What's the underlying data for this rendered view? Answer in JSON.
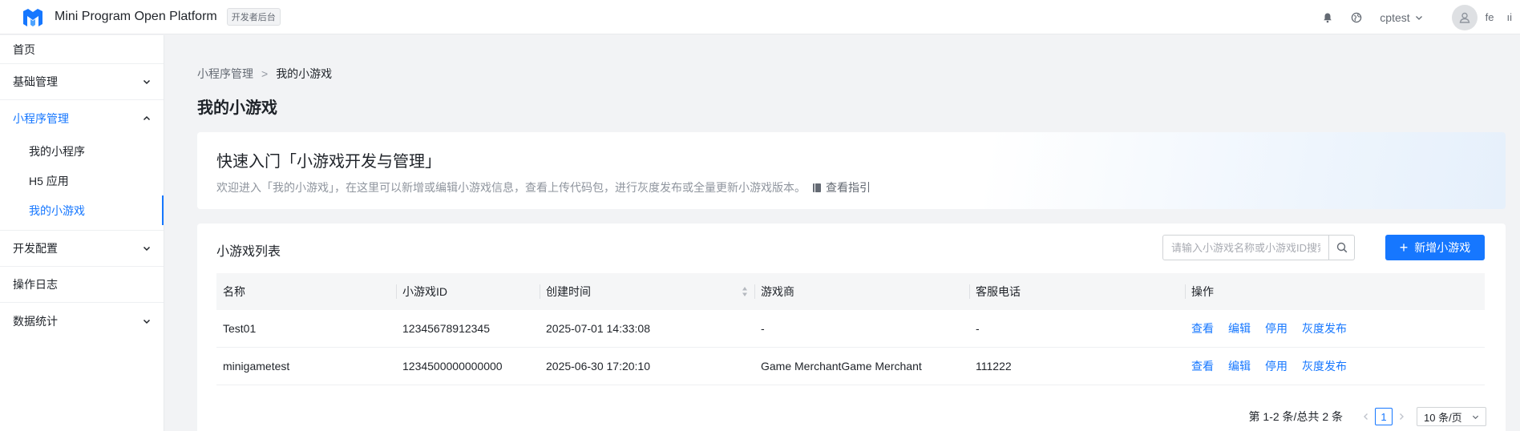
{
  "header": {
    "app_title": "Mini Program Open Platform",
    "badge": "开发者后台",
    "account": "cptest",
    "user_short": "fe",
    "user_short2": "ıi"
  },
  "sidebar": {
    "items": [
      {
        "label": "首页"
      },
      {
        "label": "基础管理"
      },
      {
        "label": "小程序管理"
      },
      {
        "label": "开发配置"
      },
      {
        "label": "操作日志"
      },
      {
        "label": "数据统计"
      }
    ],
    "sub_items": [
      {
        "label": "我的小程序"
      },
      {
        "label": "H5 应用"
      },
      {
        "label": "我的小游戏"
      }
    ]
  },
  "main": {
    "breadcrumb": {
      "parent": "小程序管理",
      "separator": ">",
      "current": "我的小游戏"
    },
    "page_title": "我的小游戏",
    "intro": {
      "title": "快速入门「小游戏开发与管理」",
      "desc": "欢迎进入「我的小游戏」，在这里可以新增或编辑小游戏信息，查看上传代码包，进行灰度发布或全量更新小游戏版本。",
      "guide": "查看指引"
    },
    "list": {
      "title": "小游戏列表",
      "search_placeholder": "请输入小游戏名称或小游戏ID搜索",
      "add_label": "新增小游戏",
      "columns": [
        "名称",
        "小游戏ID",
        "创建时间",
        "游戏商",
        "客服电话",
        "操作"
      ],
      "rows": [
        {
          "name": "Test01",
          "id": "12345678912345",
          "created": "2025-07-01 14:33:08",
          "merchant": "-",
          "phone": "-"
        },
        {
          "name": "minigametest",
          "id": "1234500000000000",
          "created": "2025-06-30 17:20:10",
          "merchant": "Game MerchantGame Merchant",
          "phone": "111222"
        }
      ],
      "actions": [
        "查看",
        "编辑",
        "停用",
        "灰度发布"
      ]
    },
    "pagination": {
      "summary": "第 1-2 条/总共 2 条",
      "current": "1",
      "page_size": "10 条/页"
    }
  },
  "colors": {
    "accent": "#1677ff",
    "text": "#1f2329",
    "muted": "#8f959e"
  }
}
